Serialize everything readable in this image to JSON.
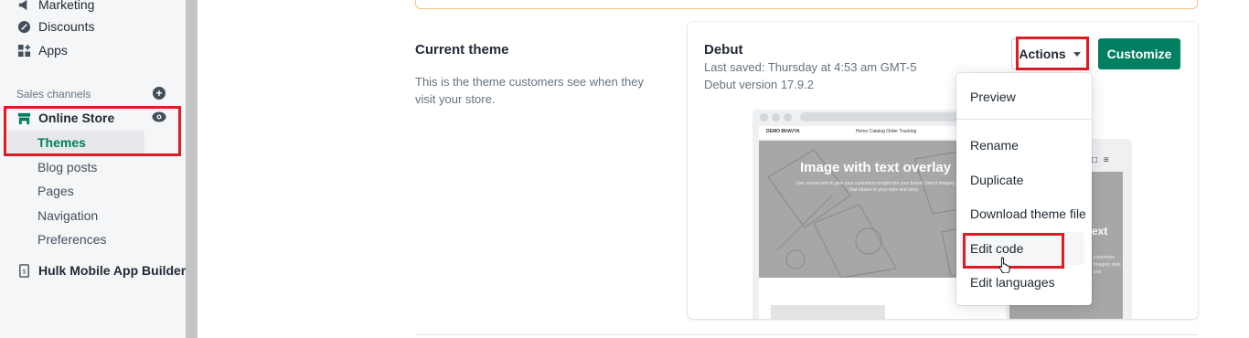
{
  "sidebar": {
    "items": [
      {
        "label": "Marketing",
        "icon": "marketing-icon"
      },
      {
        "label": "Discounts",
        "icon": "discount-icon"
      },
      {
        "label": "Apps",
        "icon": "apps-icon"
      }
    ],
    "sales_channels_label": "Sales channels",
    "online_store": {
      "label": "Online Store",
      "icon": "store-icon",
      "sub_items": [
        "Themes",
        "Blog posts",
        "Pages",
        "Navigation",
        "Preferences"
      ]
    },
    "hulk_app": {
      "label": "Hulk Mobile App Builder",
      "icon": "mobile-app-icon"
    }
  },
  "main": {
    "section_title": "Current theme",
    "section_description": "This is the theme customers see when they visit your store.",
    "theme_card": {
      "theme_name": "Debut",
      "last_saved": "Last saved: Thursday at 4:53 am GMT-5",
      "version": "Debut version 17.9.2",
      "actions_label": "Actions",
      "customize_label": "Customize",
      "preview": {
        "store_name": "DEMO BHAVYA",
        "nav_links": "Home   Catalog   Order Tracking",
        "hero_title": "Image with text overlay",
        "hero_subtitle": "Use overlay text to give your customers insight into your brand. Select imagery and text that relates to your style and story.",
        "mobile_hero_title": "ext",
        "mobile_hero_sub": "customers Imagery style and"
      }
    },
    "actions_menu": [
      "Preview",
      "Rename",
      "Duplicate",
      "Download theme file",
      "Edit code",
      "Edit languages"
    ]
  },
  "colors": {
    "accent_green": "#008060",
    "highlight_red": "#e01b24",
    "active_nav": "#007f5f"
  }
}
